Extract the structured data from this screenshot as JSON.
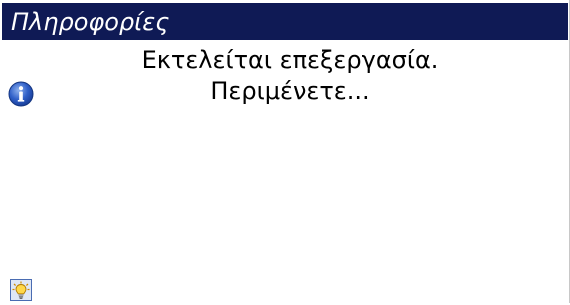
{
  "dialog": {
    "title": "Πληροφορίες",
    "message_line1": "Εκτελείται επεξεργασία.",
    "message_line2": "Περιμένετε..."
  },
  "icons": {
    "info": "info-icon",
    "tip": "lightbulb-icon"
  },
  "colors": {
    "titlebar_background": "#0f1a55",
    "title_text": "#ffffff",
    "message_text": "#000000"
  }
}
